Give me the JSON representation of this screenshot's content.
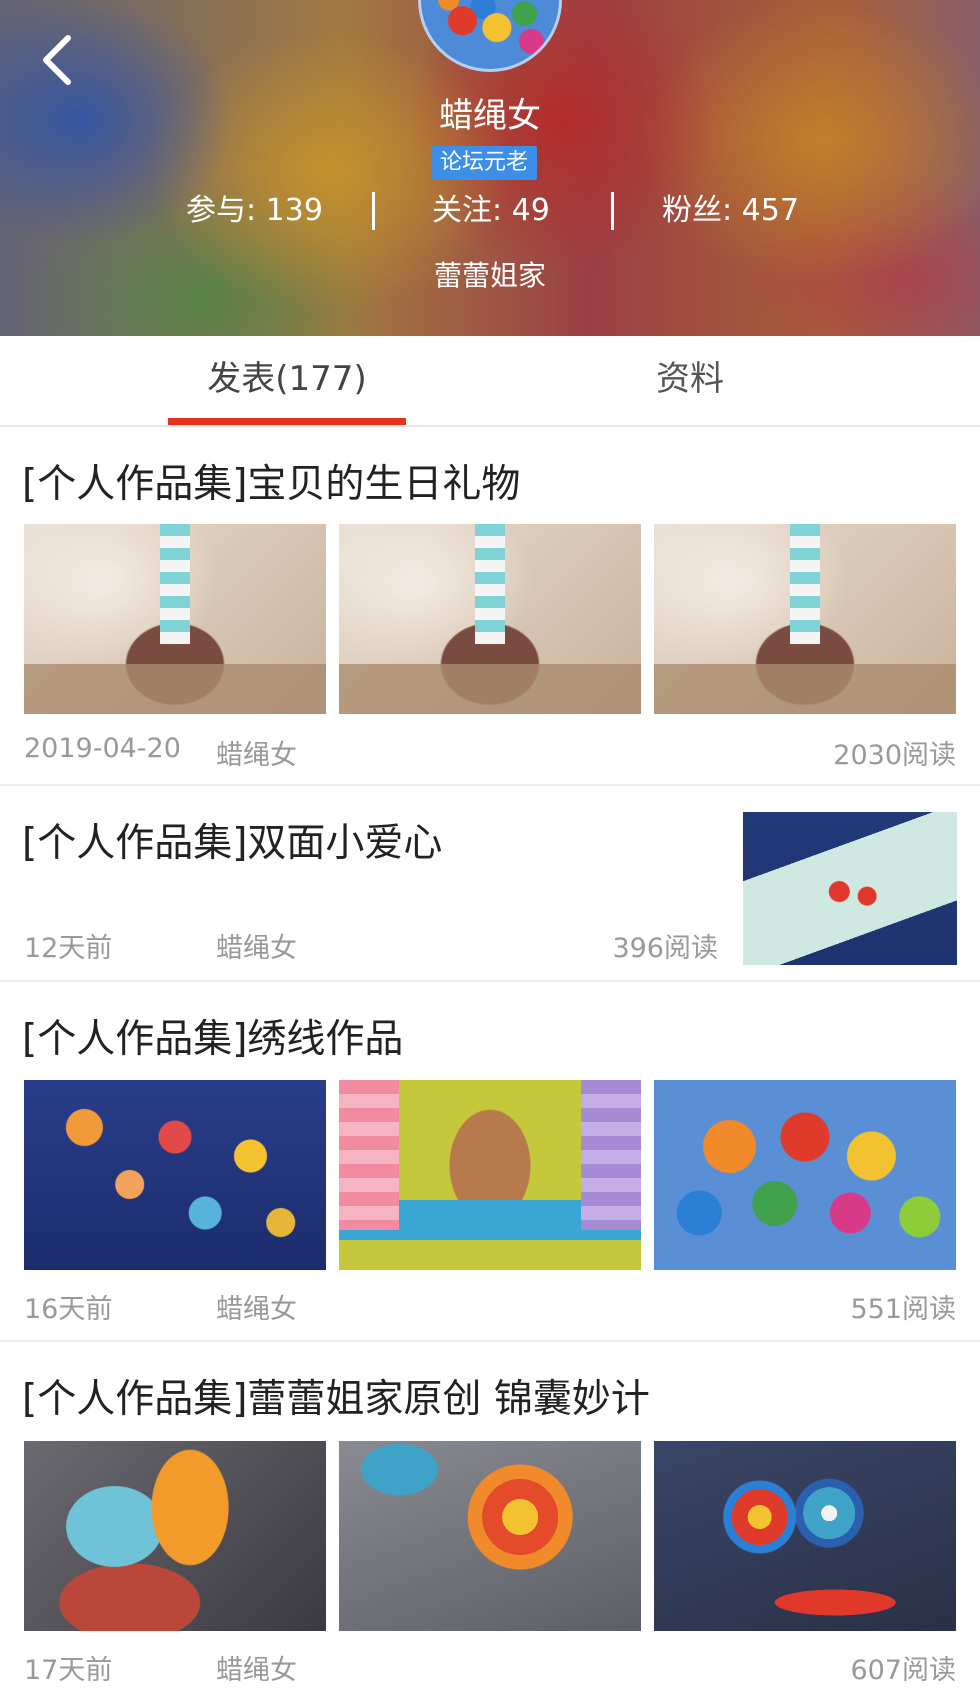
{
  "profile": {
    "username": "蜡绳女",
    "badge": "论坛元老",
    "stats": {
      "participate": "参与: 139",
      "follow": "关注: 49",
      "fans": "粉丝: 457"
    },
    "group": "蕾蕾姐家"
  },
  "tabs": {
    "posts_label": "发表(177)",
    "info_label": "资料"
  },
  "posts": [
    {
      "title": "[个人作品集]宝贝的生日礼物",
      "date": "2019-04-20",
      "author": "蜡绳女",
      "reads": "2030阅读"
    },
    {
      "title": "[个人作品集]双面小爱心",
      "date": "12天前",
      "author": "蜡绳女",
      "reads": "396阅读"
    },
    {
      "title": "[个人作品集]绣线作品",
      "date": "16天前",
      "author": "蜡绳女",
      "reads": "551阅读"
    },
    {
      "title": "[个人作品集]蕾蕾姐家原创  锦囊妙计",
      "date": "17天前",
      "author": "蜡绳女",
      "reads": "607阅读"
    }
  ],
  "colors": {
    "accent": "#e3331f",
    "badge": "#3d8ee6",
    "meta_text": "#999999"
  }
}
